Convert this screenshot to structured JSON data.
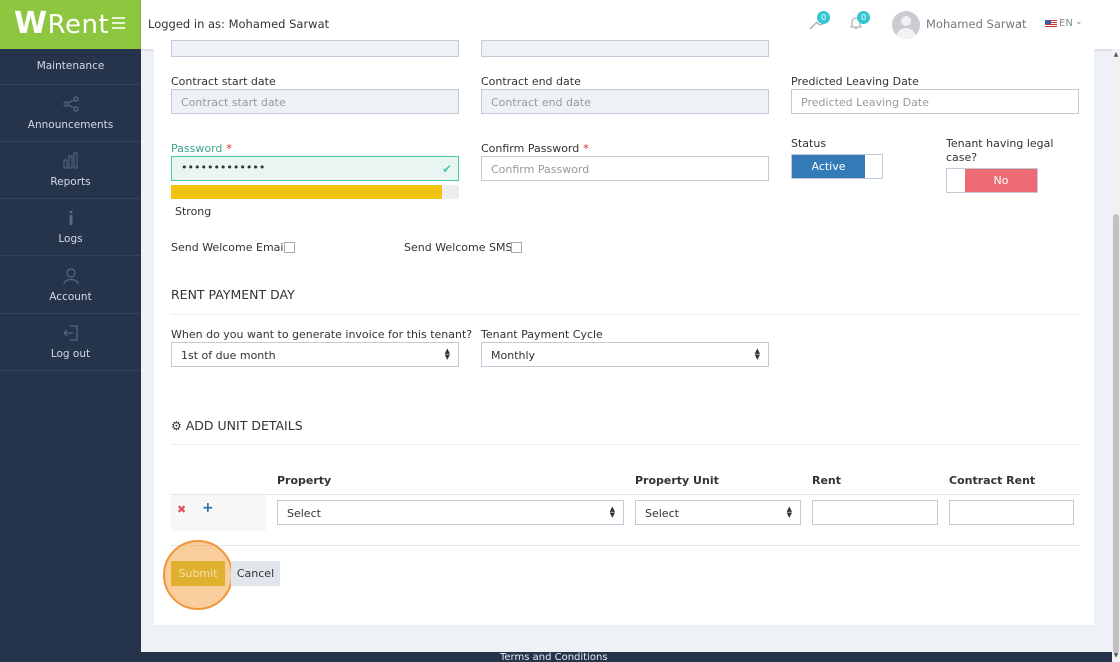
{
  "brand": {
    "logo_text": "Rent",
    "logo_letter": "W"
  },
  "sidebar": {
    "items": [
      {
        "label": "Maintenance",
        "icon": "wrench-icon"
      },
      {
        "label": "Announcements",
        "icon": "share-icon"
      },
      {
        "label": "Reports",
        "icon": "bar-chart-icon"
      },
      {
        "label": "Logs",
        "icon": "info-icon"
      },
      {
        "label": "Account",
        "icon": "user-icon"
      },
      {
        "label": "Log out",
        "icon": "logout-icon"
      }
    ]
  },
  "topbar": {
    "logged_in": "Logged in as: Mohamed Sarwat",
    "maintenance_badge": "0",
    "notifications_badge": "0",
    "user_name": "Mohamed Sarwat",
    "language": "EN"
  },
  "form": {
    "contract_start": {
      "label": "Contract start date",
      "placeholder": "Contract start date"
    },
    "contract_end": {
      "label": "Contract end date",
      "placeholder": "Contract end date"
    },
    "predicted_leaving": {
      "label": "Predicted Leaving Date",
      "placeholder": "Predicted Leaving Date"
    },
    "password": {
      "label": "Password",
      "required_mark": "*",
      "value": "•••••••••••••",
      "strength_label": "Strong",
      "strength_fraction": 0.94
    },
    "confirm_password": {
      "label": "Confirm Password",
      "required_mark": "*",
      "placeholder": "Confirm Password"
    },
    "status": {
      "label": "Status",
      "value": "Active"
    },
    "legal_case": {
      "label": "Tenant having legal case?",
      "value": "No"
    },
    "welcome_email": {
      "label": "Send Welcome Email?",
      "checked": false
    },
    "welcome_sms": {
      "label": "Send Welcome SMS?",
      "checked": false
    }
  },
  "rent_payment": {
    "title": "RENT PAYMENT DAY",
    "invoice_label": "When do you want to generate invoice for this tenant?",
    "invoice_value": "1st of due month",
    "cycle_label": "Tenant Payment Cycle",
    "cycle_value": "Monthly"
  },
  "unit_details": {
    "title": "ADD UNIT DETAILS",
    "columns": [
      "Property",
      "Property Unit",
      "Rent",
      "Contract Rent"
    ],
    "row": {
      "property": "Select",
      "property_unit": "Select",
      "rent": "",
      "contract_rent": ""
    }
  },
  "actions": {
    "submit": "Submit",
    "cancel": "Cancel"
  },
  "footer": {
    "text": "Terms and Conditions"
  },
  "colors": {
    "sidebar": "#26344b",
    "brand_green": "#8dc63f",
    "active_blue": "#337ab7",
    "no_red": "#ed6b75",
    "strength_yellow": "#f1c40f",
    "submit_gold": "#e0b02f"
  }
}
